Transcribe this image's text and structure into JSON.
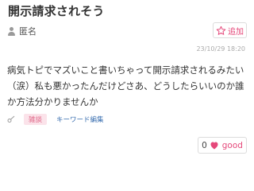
{
  "post": {
    "title": "開示請求されそう",
    "author": "匿名",
    "timestamp": "23/10/29 18:20",
    "body": "病気トピでマズいこと書いちゃって開示請求されるみたい（涙）私も悪かったんだけどさあ、どうしたらいいのか誰か方法分かりませんか"
  },
  "actions": {
    "favorite_label": "追加",
    "good_count": "0",
    "good_label": "good"
  },
  "tags": {
    "category": "雑談",
    "edit_keywords_label": "キーワード編集"
  },
  "icons": {
    "author": "user-icon",
    "favorite": "star-icon",
    "tag": "tag-icon",
    "good": "heart-icon"
  },
  "colors": {
    "accent_pink": "#e5487a",
    "link_blue": "#3a6fb0",
    "tag_bg": "#fbe3ea"
  }
}
